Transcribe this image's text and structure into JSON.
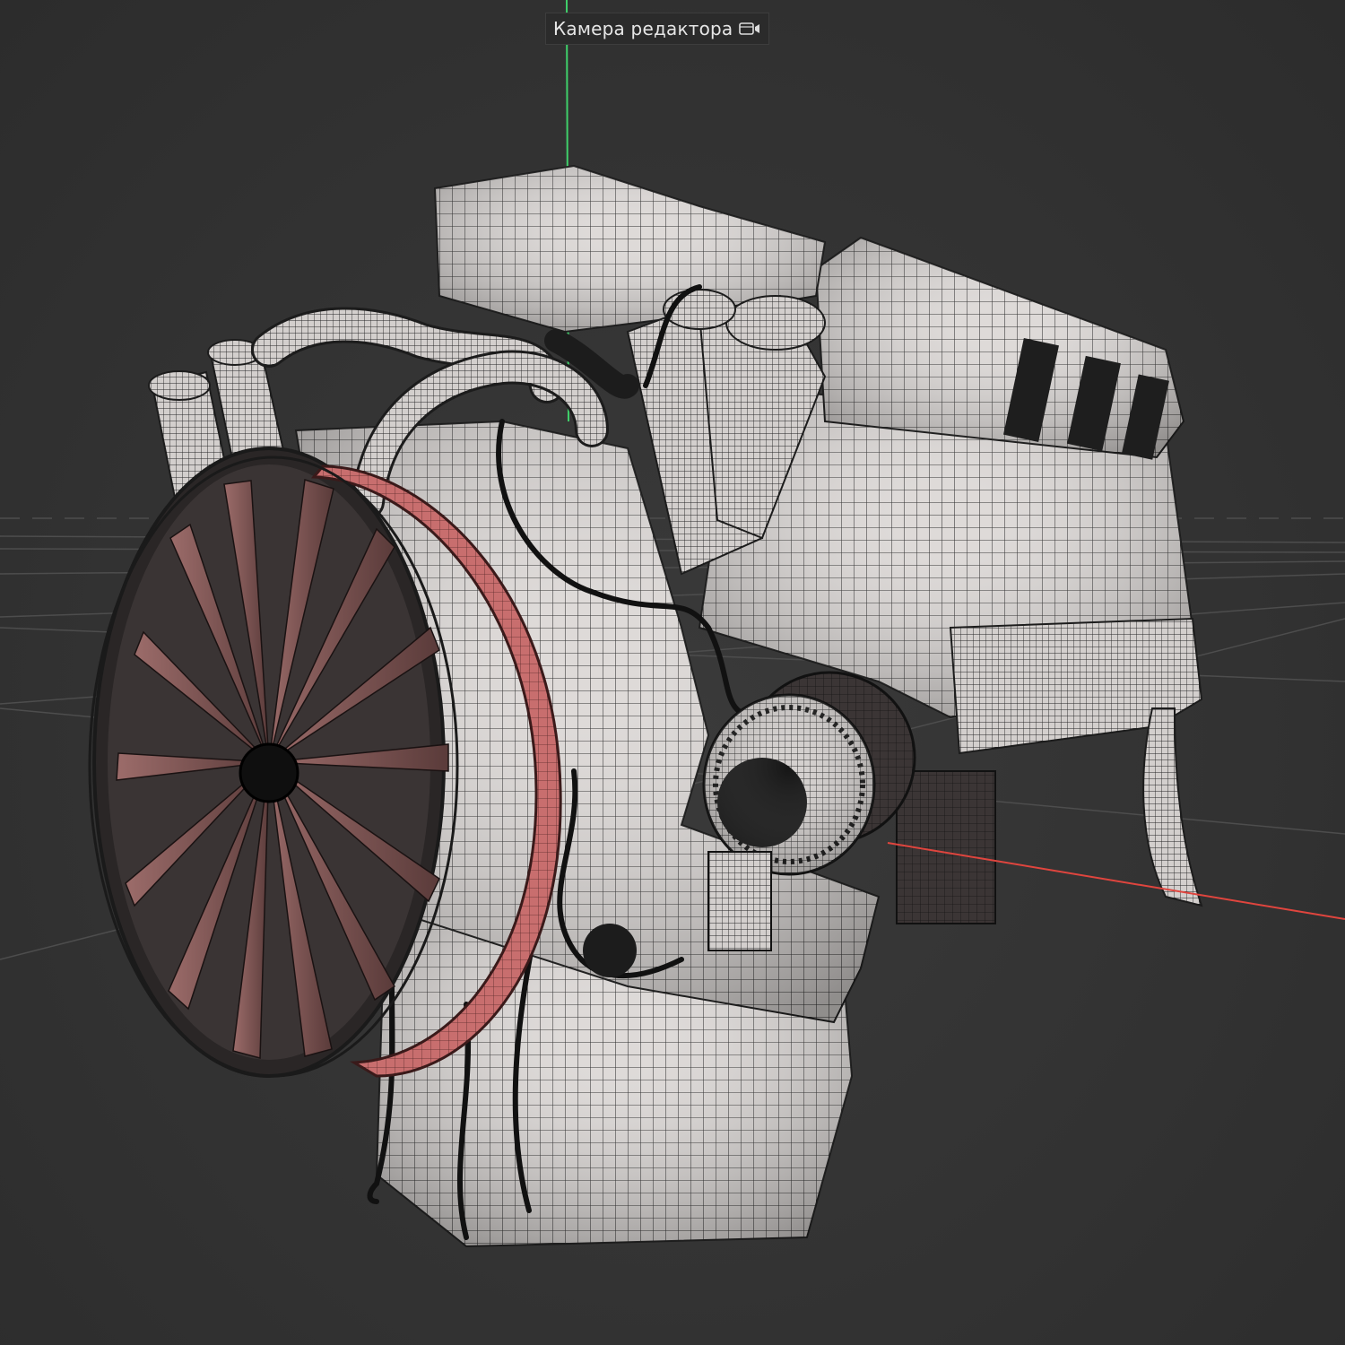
{
  "viewport": {
    "camera_label": "Камера редактора",
    "camera_icon": "camera-icon",
    "background_color": "#333333",
    "axis_colors": {
      "y_axis": "#3fd06a",
      "x_axis": "#e0453e"
    },
    "model": {
      "body_color": "#d9d4d2",
      "wire_color": "#1c1c1c",
      "flywheel_color": "#c46b6b"
    }
  }
}
